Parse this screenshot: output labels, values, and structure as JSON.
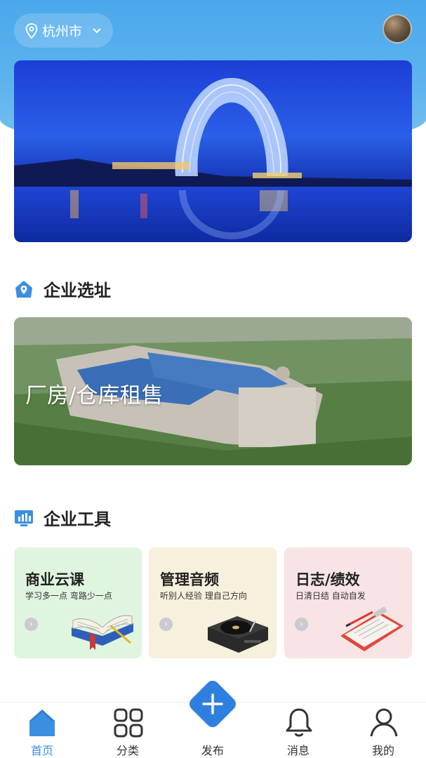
{
  "header": {
    "city": "杭州市",
    "location_icon": "location-pin-icon",
    "dropdown_icon": "chevron-down-icon"
  },
  "banner": {
    "image": "hangzhou-night-lake-hotel-photo"
  },
  "site_section": {
    "title": "企业选址",
    "icon": "house-location-icon",
    "card_label": "厂房/仓库租售"
  },
  "tools_section": {
    "title": "企业工具",
    "icon": "bar-chart-icon",
    "cards": [
      {
        "title": "商业云课",
        "subtitle": "学习多一点 弯路少一点",
        "bg": "#dff5df",
        "icon": "open-book-icon"
      },
      {
        "title": "管理音频",
        "subtitle": "听别人经验 理自己方向",
        "bg": "#f7f0dc",
        "icon": "record-player-icon"
      },
      {
        "title": "日志/绩效",
        "subtitle": "日清日结 自动自发",
        "bg": "#f8e4e4",
        "icon": "clipboard-icon"
      }
    ]
  },
  "tabbar": {
    "items": [
      {
        "label": "首页",
        "icon": "home-icon"
      },
      {
        "label": "分类",
        "icon": "grid-icon"
      },
      {
        "label": "发布",
        "icon": "plus-icon"
      },
      {
        "label": "消息",
        "icon": "bell-icon"
      },
      {
        "label": "我的",
        "icon": "user-icon"
      }
    ],
    "active": "首页",
    "accent": "#3b8fe0"
  }
}
